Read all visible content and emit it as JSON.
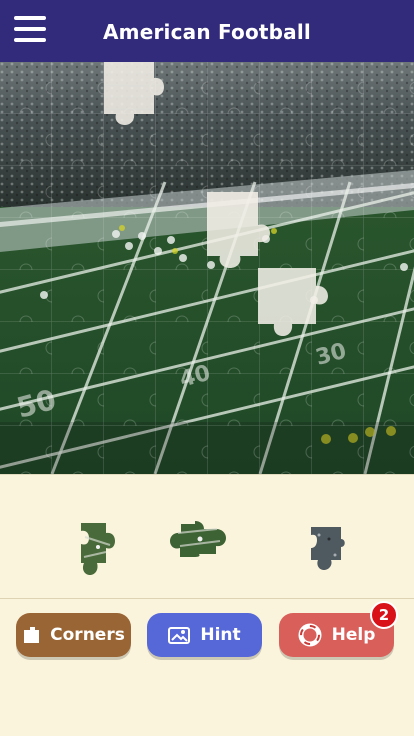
{
  "header": {
    "title": "American Football",
    "background": "#322a7a"
  },
  "board": {
    "missing_pieces": [
      {
        "row": 0,
        "col": 2
      },
      {
        "row": 3,
        "col": 4
      },
      {
        "row": 4,
        "col": 5
      }
    ],
    "piece_grid": {
      "rows": 8,
      "cols": 8
    }
  },
  "tray": {
    "pieces": [
      {
        "name": "loose-piece-1",
        "tone": "field"
      },
      {
        "name": "loose-piece-2",
        "tone": "field"
      },
      {
        "name": "loose-piece-3",
        "tone": "crowd"
      }
    ]
  },
  "actions": {
    "corners_label": "Corners",
    "hint_label": "Hint",
    "help_label": "Help",
    "help_badge": "2",
    "colors": {
      "corners": "#9a6534",
      "hint": "#5668d8",
      "help": "#d95f5b"
    }
  },
  "icons": [
    "menu-icon",
    "corners-icon",
    "image-icon",
    "lifebuoy-icon"
  ]
}
